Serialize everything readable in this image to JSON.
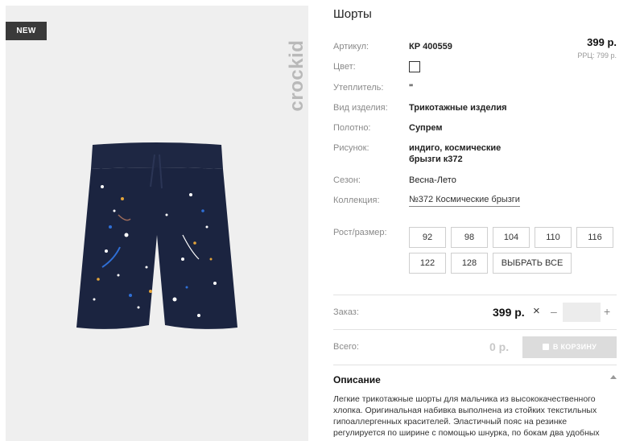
{
  "image_panel": {
    "badge": "NEW",
    "brand": "crockid"
  },
  "product": {
    "title": "Шорты",
    "price": "399 р.",
    "rrp": "РРЦ: 799 р."
  },
  "specs": [
    {
      "label": "Артикул:",
      "value": "КР 400559"
    },
    {
      "label": "Цвет:",
      "value": ""
    },
    {
      "label": "Утеплитель:",
      "value": "\""
    },
    {
      "label": "Вид изделия:",
      "value": "Трикотажные изделия"
    },
    {
      "label": "Полотно:",
      "value": "Супрем"
    },
    {
      "label": "Рисунок:",
      "value_line1": "индиго, космические",
      "value_line2": "брызги к372"
    },
    {
      "label": "Сезон:",
      "value": "Весна-Лето"
    },
    {
      "label": "Коллекция:",
      "value": "№372 Космические брызги"
    }
  ],
  "sizes": {
    "label": "Рост/размер:",
    "options": [
      "92",
      "98",
      "104",
      "110",
      "116",
      "122",
      "128"
    ],
    "select_all": "ВЫБРАТЬ ВСЕ"
  },
  "order": {
    "label": "Заказ:",
    "price": "399 р.",
    "times": "×",
    "minus": "–",
    "plus": "+",
    "quantity": ""
  },
  "total": {
    "label": "Всего:",
    "value": "0 р.",
    "cart_button": "В КОРЗИНУ"
  },
  "description": {
    "title": "Описание",
    "text": "Легкие трикотажные шорты для мальчика из высококачественного хлопка. Оригинальная набивка выполнена из стойких текстильных гипоаллергенных красителей. Эластичный пояс на резинке регулируется по ширине с помощью шнурка, по бокам два удобных"
  },
  "colors": {
    "badge_bg": "#3a3a3a",
    "shorts": "#1b2440",
    "swatch_border": "#333333"
  }
}
